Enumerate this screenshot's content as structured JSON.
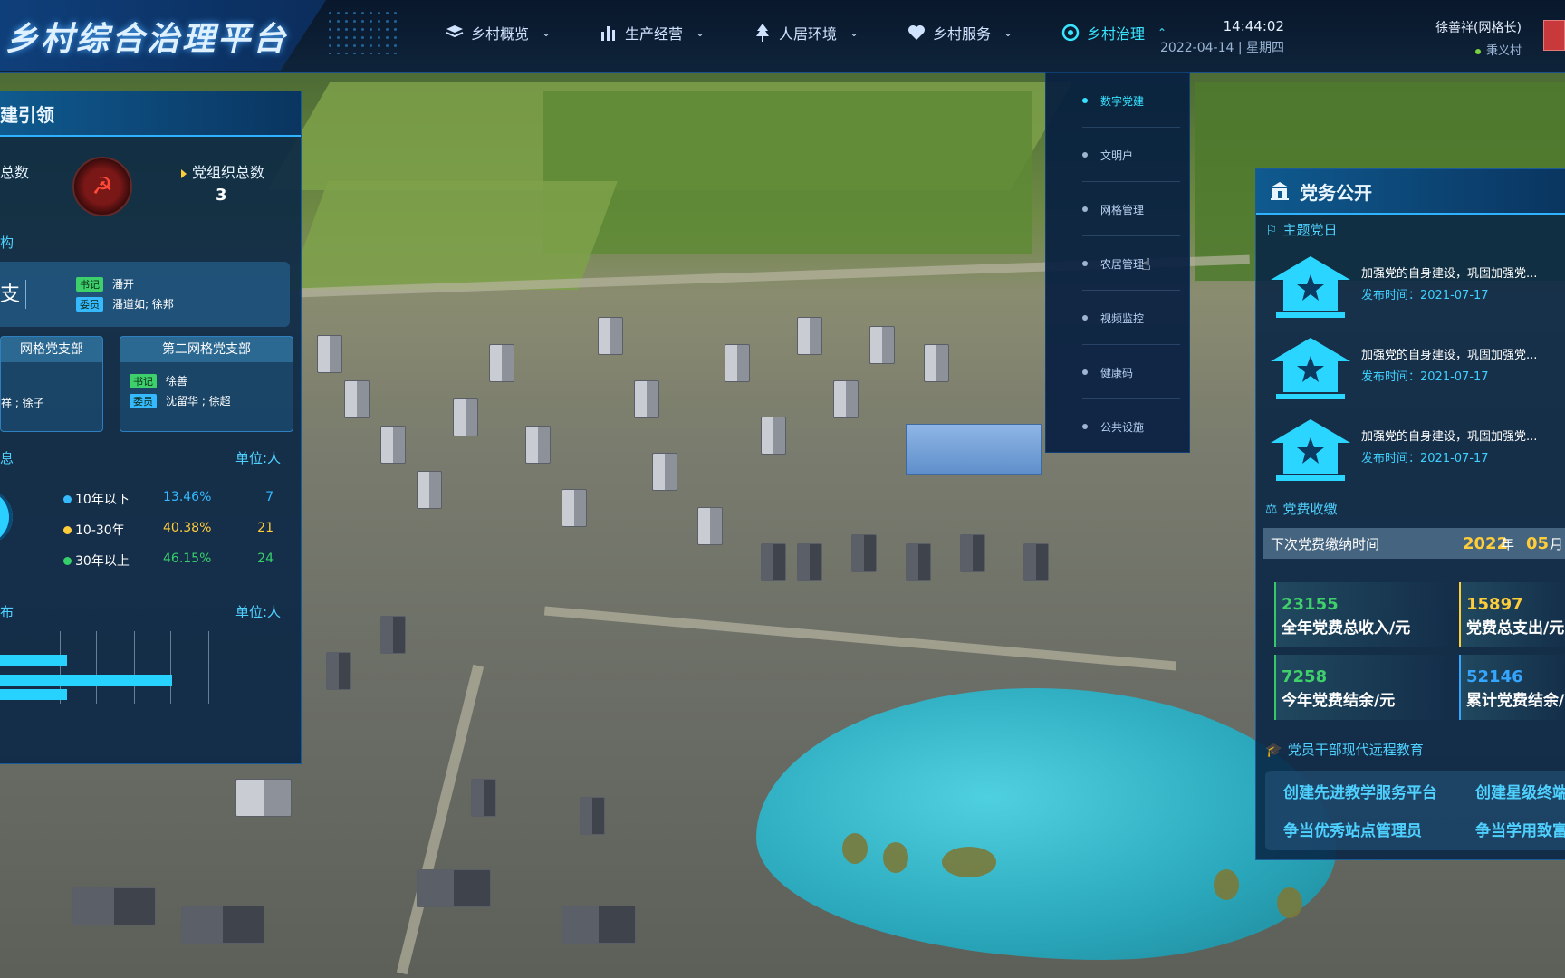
{
  "header": {
    "app_title": "乡村综合治理平台",
    "nav": [
      {
        "label": "乡村概览",
        "icon": "layers-icon"
      },
      {
        "label": "生产经营",
        "icon": "bar-chart-icon"
      },
      {
        "label": "人居环境",
        "icon": "tree-icon"
      },
      {
        "label": "乡村服务",
        "icon": "heart-icon"
      },
      {
        "label": "乡村治理",
        "icon": "governance-icon",
        "active": true
      }
    ],
    "time": "14:44:02",
    "date": "2022-04-14 | 星期四",
    "user_name": "徐善祥(网格长)",
    "village": "秉义村"
  },
  "dropdown": {
    "items": [
      "数字党建",
      "文明户",
      "网格管理",
      "农居管理",
      "视频监控",
      "健康码",
      "公共设施"
    ],
    "selected": "数字党建"
  },
  "left_panel": {
    "title": "建引领",
    "stat_left_label": "总数",
    "org_total_label": "党组织总数",
    "org_total_value": "3",
    "structure_label": "构",
    "main_org_char": "支",
    "main_secretary_tag": "书记",
    "main_secretary": "潘开",
    "main_members_tag": "委员",
    "main_members": "潘道如; 徐邦",
    "branch1_title": "网格党支部",
    "branch1_members": "祥 ; 徐子",
    "branch2_title": "第二网格党支部",
    "branch2_secretary_tag": "书记",
    "branch2_secretary": "徐善",
    "branch2_members_tag": "委员",
    "branch2_members": "沈留华 ; 徐超",
    "party_age_label": "息",
    "unit_label": "单位:人",
    "party_age": [
      {
        "label": "10年以下",
        "percent": "13.46%",
        "count": "7",
        "color": "#35b9ff"
      },
      {
        "label": "10-30年",
        "percent": "40.38%",
        "count": "21",
        "color": "#ffcc3a"
      },
      {
        "label": "30年以上",
        "percent": "46.15%",
        "count": "24",
        "color": "#36d06b"
      }
    ],
    "distribution_label": "布",
    "distribution_unit": "单位:人"
  },
  "right_panel": {
    "title": "党务公开",
    "theme_day_label": "主题党日",
    "news": [
      {
        "title": "加强党的自身建设，巩固加强党...",
        "time": "发布时间：2021-07-17"
      },
      {
        "title": "加强党的自身建设，巩固加强党...",
        "time": "发布时间：2021-07-17"
      },
      {
        "title": "加强党的自身建设，巩固加强党...",
        "time": "发布时间：2021-07-17"
      }
    ],
    "fee_label": "党费收缴",
    "next_pay_label": "下次党费缴纳时间",
    "next_pay_year": "2022",
    "year_char": "年",
    "next_pay_month": "05",
    "month_char": "月",
    "kpis": [
      {
        "value": "23155",
        "label": "全年党费总收入/元",
        "color": "#3fd06b"
      },
      {
        "value": "15897",
        "label": "党费总支出/元",
        "color": "#ffcc3a"
      },
      {
        "value": "7258",
        "label": "今年党费结余/元",
        "color": "#3fd06b"
      },
      {
        "value": "52146",
        "label": "累计党费结余/",
        "color": "#35a6ff"
      }
    ],
    "edu_label": "党员干部现代远程教育",
    "edu_items": [
      "创建先进教学服务平台",
      "创建星级终端",
      "争当优秀站点管理员",
      "争当学用致富"
    ]
  }
}
